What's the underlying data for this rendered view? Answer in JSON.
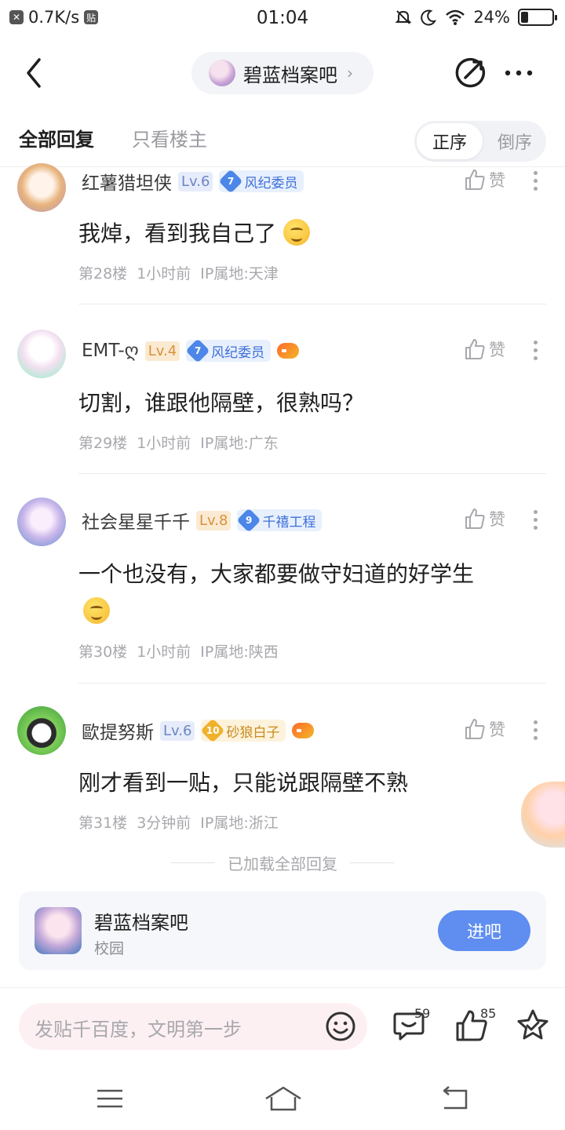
{
  "status_bar": {
    "speed": "0.7K/s",
    "sticker": "贴",
    "time": "01:04",
    "battery": "24%",
    "battery_level": 0.24
  },
  "header": {
    "forum_name": "碧蓝档案吧"
  },
  "tabs": {
    "all": "全部回复",
    "op_only": "只看楼主",
    "sort_asc": "正序",
    "sort_desc": "倒序"
  },
  "replies": [
    {
      "username": "红薯猎坦侠",
      "level": "Lv.6",
      "badge_num": "7",
      "badge_label": "风纪委员",
      "text": "我焯，看到我自己了",
      "floor": "第28楼",
      "time": "1小时前",
      "ip": "IP属地:天津",
      "like": "赞"
    },
    {
      "username": "EMT-ღ",
      "level": "Lv.4",
      "badge_num": "7",
      "badge_label": "风纪委员",
      "text": "切割，谁跟他隔壁，很熟吗？",
      "floor": "第29楼",
      "time": "1小时前",
      "ip": "IP属地:广东",
      "like": "赞"
    },
    {
      "username": "社会星星千千",
      "level": "Lv.8",
      "badge_num": "9",
      "badge_label": "千禧工程",
      "text": "一个也没有，大家都要做守妇道的好学生",
      "floor": "第30楼",
      "time": "1小时前",
      "ip": "IP属地:陕西",
      "like": "赞"
    },
    {
      "username": "歐提努斯",
      "level": "Lv.6",
      "badge_num": "10",
      "badge_label": "砂狼白子",
      "text": "刚才看到一贴，只能说跟隔壁不熟",
      "floor": "第31楼",
      "time": "3分钟前",
      "ip": "IP属地:浙江",
      "like": "赞"
    }
  ],
  "loaded_all": "已加载全部回复",
  "forum_card": {
    "name": "碧蓝档案吧",
    "category": "校园",
    "enter": "进吧"
  },
  "bottom_bar": {
    "input_placeholder": "发贴千百度，文明第一步",
    "comment_count": "59",
    "like_count": "85"
  }
}
